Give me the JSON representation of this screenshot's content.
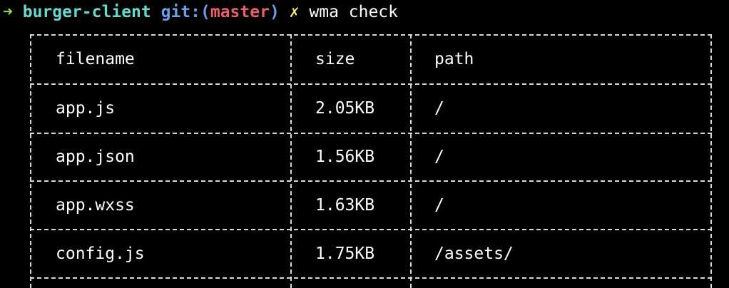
{
  "prompt": {
    "arrow": "➜",
    "directory": "burger-client",
    "git_prefix": "git:(",
    "branch": "master",
    "git_suffix": ")",
    "dirty_marker": "✗",
    "command": "wma check"
  },
  "table": {
    "headers": {
      "filename": "filename",
      "size": "size",
      "path": "path"
    },
    "rows": [
      {
        "filename": "app.js",
        "size": "2.05KB",
        "path": "/"
      },
      {
        "filename": "app.json",
        "size": "1.56KB",
        "path": "/"
      },
      {
        "filename": "app.wxss",
        "size": "1.63KB",
        "path": "/"
      },
      {
        "filename": "config.js",
        "size": "1.75KB",
        "path": "/assets/"
      }
    ]
  },
  "colors": {
    "background": "#000000",
    "arrow": "#8be04e",
    "directory": "#67d8d0",
    "git": "#6a9fea",
    "branch": "#e8616a",
    "dirty": "#f5e66a",
    "border": "#d8d8d8"
  }
}
